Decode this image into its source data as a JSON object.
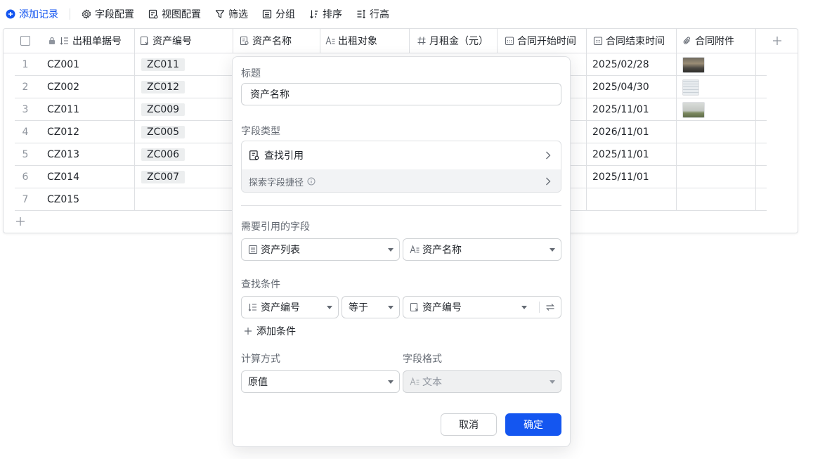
{
  "toolbar": {
    "add_record": "添加记录",
    "field_config": "字段配置",
    "view_config": "视图配置",
    "filter": "筛选",
    "group": "分组",
    "sort": "排序",
    "row_height": "行高"
  },
  "table": {
    "columns": [
      "出租单据号",
      "资产编号",
      "资产名称",
      "出租对象",
      "月租金（元）",
      "合同开始时间",
      "合同结束时间",
      "合同附件"
    ],
    "rows": [
      {
        "num": "1",
        "doc": "CZ001",
        "asset": "ZC011",
        "end": "2025/02/28"
      },
      {
        "num": "2",
        "doc": "CZ002",
        "asset": "ZC012",
        "end": "2025/04/30"
      },
      {
        "num": "3",
        "doc": "CZ011",
        "asset": "ZC009",
        "end": "2025/11/01"
      },
      {
        "num": "4",
        "doc": "CZ012",
        "asset": "ZC005",
        "end": "2026/11/01"
      },
      {
        "num": "5",
        "doc": "CZ013",
        "asset": "ZC006",
        "end": "2025/11/01"
      },
      {
        "num": "6",
        "doc": "CZ014",
        "asset": "ZC007",
        "end": "2025/11/01"
      },
      {
        "num": "7",
        "doc": "CZ015",
        "asset": "",
        "end": ""
      }
    ]
  },
  "popover": {
    "title_label": "标题",
    "title_value": "资产名称",
    "field_type_label": "字段类型",
    "field_type_value": "查找引用",
    "explore_shortcut": "探索字段捷径",
    "ref_field_label": "需要引用的字段",
    "ref_table": "资产列表",
    "ref_field": "资产名称",
    "condition_label": "查找条件",
    "cond_field": "资产编号",
    "cond_op": "等于",
    "cond_target": "资产编号",
    "add_condition": "添加条件",
    "calc_label": "计算方式",
    "calc_value": "原值",
    "format_label": "字段格式",
    "format_value": "文本",
    "cancel": "取消",
    "confirm": "确定"
  },
  "colors": {
    "accent": "#1456f0",
    "border": "#dee0e3"
  }
}
